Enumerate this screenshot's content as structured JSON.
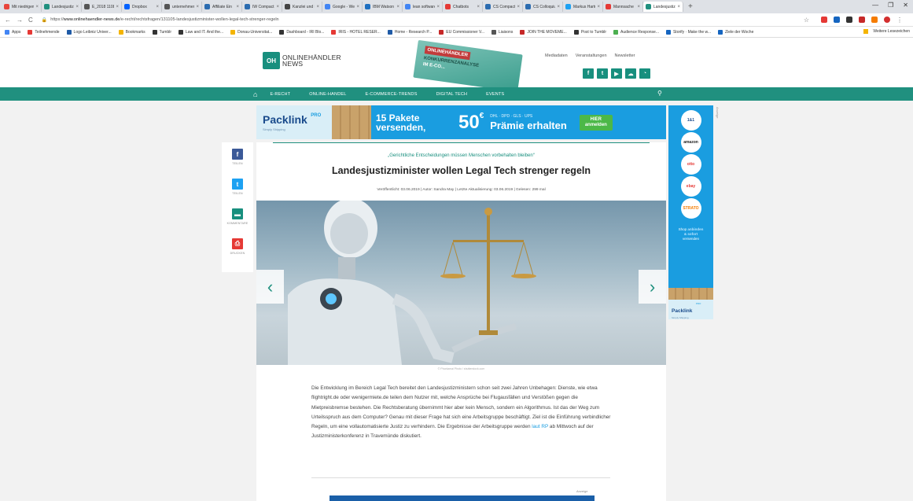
{
  "browser": {
    "tabs": [
      {
        "title": "Mit niedrigem",
        "color": "#e8453c"
      },
      {
        "title": "Landesjustizmi",
        "color": "#20907f"
      },
      {
        "title": "E_2018 1108",
        "color": "#555555"
      },
      {
        "title": "Dropbox",
        "color": "#0061fe"
      },
      {
        "title": "unternehmen",
        "color": "#555555"
      },
      {
        "title": "Affiliate Ein",
        "color": "#2b6cb0"
      },
      {
        "title": "IW Compact",
        "color": "#2b6cb0"
      },
      {
        "title": "Kanzlei und Int",
        "color": "#444444"
      },
      {
        "title": "Google - We",
        "color": "#4285f4"
      },
      {
        "title": "IBM Watson",
        "color": "#1f70c1"
      },
      {
        "title": "lean software",
        "color": "#4285f4"
      },
      {
        "title": "Chatbots",
        "color": "#e53935"
      },
      {
        "title": "CS Compact",
        "color": "#2b6cb0"
      },
      {
        "title": "CS Colloquium",
        "color": "#2b6cb0"
      },
      {
        "title": "Markus Hartu",
        "color": "#1da1f2"
      },
      {
        "title": "Mannsache",
        "color": "#e53935"
      },
      {
        "title": "Landesjustizm",
        "color": "#20907f",
        "active": true
      }
    ],
    "url_prefix": "https://",
    "url_domain": "www.onlinehaendler-news.de",
    "url_path": "/e-recht/rechtsfragen/131105-landesjustizminister-wollen-legal-tech-strenger-regeln",
    "bookmarks": [
      {
        "label": "Apps",
        "color": "#4285f4"
      },
      {
        "label": "Teilnehmende",
        "color": "#e53935"
      },
      {
        "label": "Logo Leibniz Univer...",
        "color": "#1f5aa6"
      },
      {
        "label": "Bookmarks",
        "color": "#f4b400"
      },
      {
        "label": "Tumblr",
        "color": "#333333"
      },
      {
        "label": "Law and IT. And the...",
        "color": "#333333"
      },
      {
        "label": "Donau-Universitat...",
        "color": "#f4b400"
      },
      {
        "label": "Dashboard - IRI Blo...",
        "color": "#333333"
      },
      {
        "label": "IRIS - HOTEL RESER...",
        "color": "#e53935"
      },
      {
        "label": "Home - Research P...",
        "color": "#1f5aa6"
      },
      {
        "label": "EU Commissioner V...",
        "color": "#c62828"
      },
      {
        "label": "Liaisons",
        "color": "#555555"
      },
      {
        "label": "JOIN THE MOVEME...",
        "color": "#c62828"
      },
      {
        "label": "Post to Tumblr",
        "color": "#333333"
      },
      {
        "label": "Audience Response...",
        "color": "#4caf50"
      },
      {
        "label": "Storify · Make the w...",
        "color": "#1565c0"
      },
      {
        "label": "Ziele der Woche",
        "color": "#1565c0"
      }
    ],
    "other_bookmarks": "Weitere Lesezeichen"
  },
  "site": {
    "logo_mark": "OH",
    "logo_line1": "ONLINEHÄNDLER",
    "logo_line2": "NEWS",
    "promo_line1": "ONLINEHÄNDLER",
    "promo_line2": "KONKURRENZANALYSE",
    "promo_line3": "IM E-CO...",
    "header_links": [
      "Mediadaten",
      "Veranstaltungen",
      "Newsletter"
    ],
    "social": [
      "f",
      "t",
      "▶",
      "☁",
      "rss"
    ],
    "nav": [
      "E-RECHT",
      "ONLINE-HANDEL",
      "E-COMMERCE-TRENDS",
      "DIGITAL TECH",
      "EVENTS"
    ]
  },
  "banner_ad": {
    "brand": "Packlink",
    "brand_tag": "PRO",
    "brand_sub": "Simply Shipping",
    "line1": "15 Pakete",
    "line2": "versenden,",
    "amount": "50",
    "currency": "€",
    "carriers": "DHL · DPD · GLS · UPS",
    "bonus": "Prämie erhalten",
    "cta1": "HIER",
    "cta2": "anmelden"
  },
  "ad_label": "Anzeige",
  "share": [
    {
      "icon": "f",
      "label": "TEILEN",
      "color": "#3b5998"
    },
    {
      "icon": "t",
      "label": "TEILEN",
      "color": "#1da1f2"
    },
    {
      "icon": "▬",
      "label": "KOMMENTARE",
      "color": "#188f7e"
    },
    {
      "icon": "⎙",
      "label": "DRUCKEN",
      "color": "#e53935"
    }
  ],
  "article": {
    "kicker": "„Gerichtliche Entscheidungen müssen Menschen vorbehalten bleiben“",
    "headline": "Landesjustizminister wollen Legal Tech strenger regeln",
    "meta": "Veröffentlicht: 03.06.2019 | Autor: Sandra May | Letzte Aktualisierung: 03.06.2019 | Gelesen: 299 mal",
    "image_credit": "© Phonlamai Photo / shutterstock.com",
    "body_before_link": "Die Entwicklung im Bereich Legal Tech bereitet den Landesjustizministern schon seit zwei Jahren Unbehagen: Dienste, wie etwa flightright.de oder wenigermiete.de teilen dem Nutzer mit, welche Ansprüche bei Flugausfällen und Verstößen gegen die Mietpreisbremse bestehen. Die Rechtsberatung übernimmt hier aber kein Mensch, sondern ein Algorithmus. Ist das der Weg zum Urteilsspruch aus dem Computer? Genau mit dieser Frage hat sich eine Arbeitsgruppe beschäftigt. Ziel ist die Einführung verbindlicher Regeln, um eine vollautomatisierte Justiz zu verhindern. Die Ergebnisse der Arbeitsgruppe werden ",
    "body_link": "laut RP",
    "body_after_link": " ab Mittwoch auf der Justizministerkonferenz in Travemünde diskutiert.",
    "anzeige": "Anzeige"
  },
  "sky_ad": {
    "brands": [
      "1&1",
      "amazon",
      "otto",
      "ebay",
      "STRATO"
    ],
    "text_line1": "Shop ",
    "text_bold": "anbinden",
    "text_line2": "& sofort",
    "text_line3": "versenden",
    "foot_brand": "Packlink",
    "foot_tag": "PRO",
    "foot_sub": "Simply Shipping"
  }
}
